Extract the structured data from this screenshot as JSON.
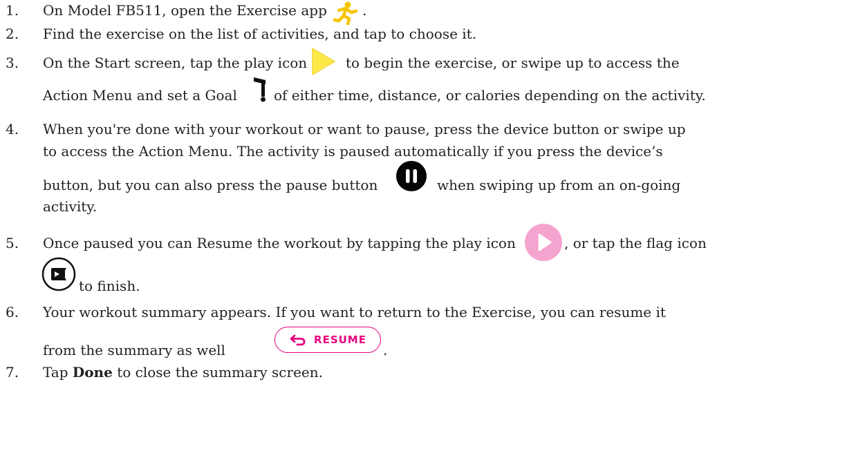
{
  "steps": [
    {
      "number": "1.",
      "lines": [
        "On Model FB511, open the Exercise app",
        "."
      ]
    },
    {
      "number": "2.",
      "lines": [
        "Find the exercise on the list of activities, and tap to choose it."
      ]
    },
    {
      "number": "3.",
      "lines": [
        "On the Start screen, tap the play icon",
        "to begin the exercise, or swipe up to access the",
        "Action Menu and set a Goal",
        "of either time, distance, or calories depending on the activity."
      ]
    },
    {
      "number": "4.",
      "lines": [
        "When you're done with your workout or want to pause, press the device button or swipe up",
        "to access the Action Menu. The activity is paused automatically if you press the device’s",
        "button, but you can also press the pause button",
        "when swiping up from an on-going",
        "activity."
      ]
    },
    {
      "number": "5.",
      "lines": [
        "Once paused you can Resume the workout by tapping the play icon",
        ", or tap the flag icon",
        "to finish."
      ]
    },
    {
      "number": "6.",
      "lines": [
        "Your workout summary appears. If you want to return to the Exercise, you can resume it",
        "from the summary as well",
        "."
      ]
    },
    {
      "number": "7.",
      "lines": [
        "Tap",
        "Done",
        "to close the summary screen."
      ]
    }
  ],
  "resume_button": {
    "label": "RESUME",
    "color": "#e6007e"
  },
  "icons": {
    "exercise_app": "running-person-icon",
    "play_start": "play-triangle-icon",
    "goal": "goal-flag-icon",
    "pause": "pause-circle-icon",
    "resume_play": "play-circle-icon",
    "finish": "finish-flag-circle-icon",
    "resume_arrow": "return-arrow-icon"
  },
  "colors": {
    "text": "#222222",
    "exercise_icon": "#f5c400",
    "play_triangle": "#fde84a",
    "play_circle": "#f5a3cf",
    "resume_accent": "#e6007e"
  }
}
